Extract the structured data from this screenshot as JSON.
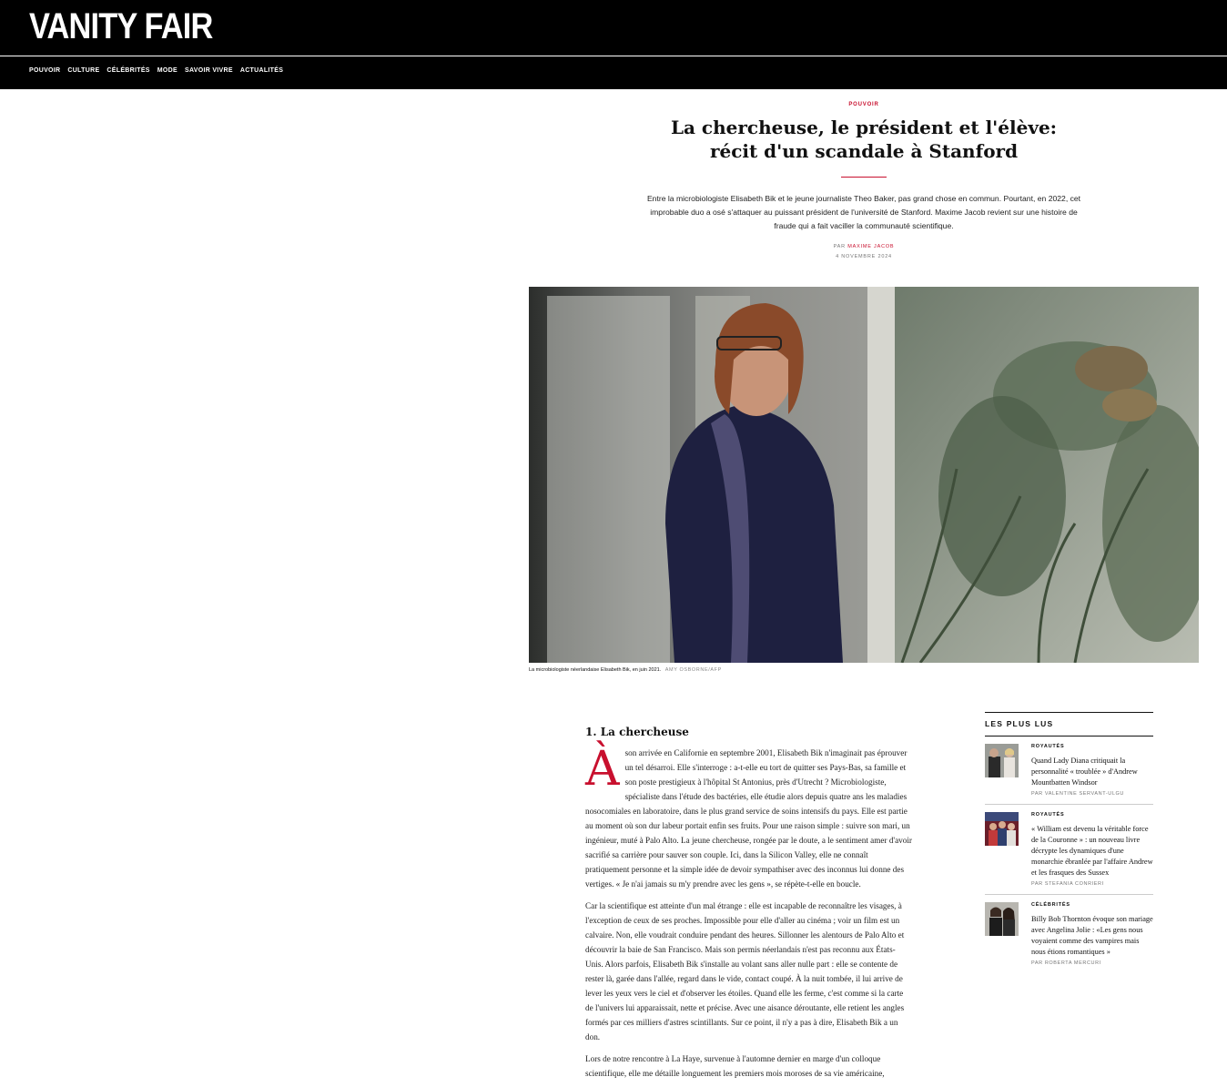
{
  "site": {
    "logo": "VANITY FAIR",
    "nav": [
      "POUVOIR",
      "CULTURE",
      "CÉLÉBRITÉS",
      "MODE",
      "SAVOIR VIVRE",
      "ACTUALITÉS"
    ]
  },
  "article": {
    "rubric": "POUVOIR",
    "title": "La chercheuse, le président et l'élève: récit d'un scandale à Stanford",
    "dek": "Entre la microbiologiste Elisabeth Bik et le jeune journaliste Theo Baker, pas grand chose en commun. Pourtant, en 2022, cet improbable duo a osé s'attaquer au puissant président de l'université de Stanford. Maxime Jacob revient sur une histoire de fraude qui a fait vaciller la communauté scientifique.",
    "byline_prefix": "PAR",
    "author": "MAXIME JACOB",
    "date": "4 NOVEMBRE 2024",
    "image_caption": "La microbiologiste néerlandaise Elisabeth Bik, en juin 2021.",
    "image_credit": "AMY OSBORNE/AFP",
    "section_heading": "1. La chercheuse",
    "dropcap": "À",
    "paragraph1": "son arrivée en Californie en septembre 2001, Elisabeth Bik n'imaginait pas éprouver un tel désarroi. Elle s'interroge : a-t-elle eu tort de quitter ses Pays-Bas, sa famille et son poste prestigieux à l'hôpital St Antonius, près d'Utrecht ? Microbiologiste, spécialiste dans l'étude des bactéries, elle étudie alors depuis quatre ans les maladies nosocomiales en laboratoire, dans le plus grand service de soins intensifs du pays. Elle est partie au moment où son dur labeur portait enfin ses fruits. Pour une raison simple : suivre son mari, un ingénieur, muté à Palo Alto. La jeune chercheuse, rongée par le doute, a le sentiment amer d'avoir sacrifié sa carrière pour sauver son couple. Ici, dans la Silicon Valley, elle ne connaît pratiquement personne et la simple idée de devoir sympathiser avec des inconnus lui donne des vertiges. « Je n'ai jamais su m'y prendre avec les gens », se répète-t-elle en boucle.",
    "paragraph2": "Car la scientifique est atteinte d'un mal étrange : elle est incapable de reconnaître les visages, à l'exception de ceux de ses proches. Impossible pour elle d'aller au cinéma ; voir un film est un calvaire. Non, elle voudrait conduire pendant des heures. Sillonner les alentours de Palo Alto et découvrir la baie de San Francisco. Mais son permis néerlandais n'est pas reconnu aux États-Unis. Alors parfois, Elisabeth Bik s'installe au volant sans aller nulle part : elle se contente de rester là, garée dans l'allée, regard dans le vide, contact coupé. À la nuit tombée, il lui arrive de lever les yeux vers le ciel et d'observer les étoiles. Quand elle les ferme, c'est comme si la carte de l'univers lui apparaissait, nette et précise. Avec une aisance déroutante, elle retient les angles formés par ces milliers d'astres scintillants. Sur ce point, il n'y a pas à dire, Elisabeth Bik a un don.",
    "paragraph3": "Lors de notre rencontre à La Haye, survenue à l'automne dernier en marge d'un colloque scientifique, elle me détaille longuement les premiers mois moroses de sa vie américaine,"
  },
  "sidebar": {
    "title": "LES PLUS LUS",
    "items": [
      {
        "category": "ROYAUTÉS",
        "headline": "Quand Lady Diana critiquait la personnalité « troublée » d'Andrew Mountbatten Windsor",
        "byline": "PAR VALENTINE SERVANT-ULGU"
      },
      {
        "category": "ROYAUTÉS",
        "headline": "« William est devenu la véritable force de la Couronne » : un nouveau livre décrypte les dynamiques d'une monarchie ébranlée par l'affaire Andrew et les frasques des Sussex",
        "byline": "PAR STEFANIA CONRIERI"
      },
      {
        "category": "CÉLÉBRITÉS",
        "headline": "Billy Bob Thornton évoque son mariage avec Angelina Jolie : «Les gens nous voyaient comme des vampires mais nous étions romantiques »",
        "byline": "PAR ROBERTA MERCURI"
      }
    ]
  },
  "colors": {
    "accent": "#c8102e",
    "bar": "#000000"
  }
}
